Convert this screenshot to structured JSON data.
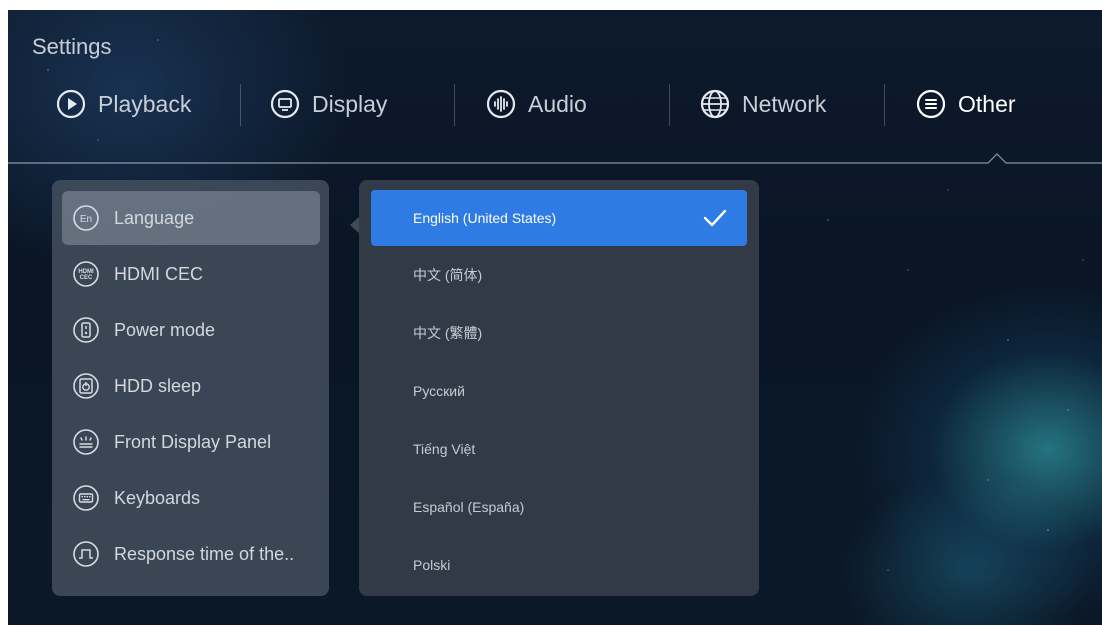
{
  "title": "Settings",
  "tabs": [
    {
      "label": "Playback",
      "icon": "play-circle-icon"
    },
    {
      "label": "Display",
      "icon": "display-icon"
    },
    {
      "label": "Audio",
      "icon": "audio-wave-icon"
    },
    {
      "label": "Network",
      "icon": "globe-icon"
    },
    {
      "label": "Other",
      "icon": "menu-circle-icon"
    }
  ],
  "active_tab": "Other",
  "menu": {
    "items": [
      {
        "label": "Language",
        "icon": "language-icon",
        "icon_text": "En"
      },
      {
        "label": "HDMI CEC",
        "icon": "hdmi-cec-icon",
        "icon_text": "HDMI CEC"
      },
      {
        "label": "Power mode",
        "icon": "power-mode-icon"
      },
      {
        "label": "HDD sleep",
        "icon": "hdd-sleep-icon"
      },
      {
        "label": "Front Display Panel",
        "icon": "front-display-icon"
      },
      {
        "label": "Keyboards",
        "icon": "keyboard-icon"
      },
      {
        "label": "Response time of the..",
        "icon": "pulse-icon"
      }
    ],
    "selected": "Language"
  },
  "languages": {
    "options": [
      {
        "label": "English (United States)"
      },
      {
        "label": "中文 (简体)"
      },
      {
        "label": "中文 (繁體)"
      },
      {
        "label": "Русский"
      },
      {
        "label": "Tiếng Việt"
      },
      {
        "label": "Español (España)"
      },
      {
        "label": "Polski"
      }
    ],
    "selected": "English (United States)"
  },
  "colors": {
    "accent": "#2d7be3",
    "panel": "#465060",
    "text": "#d3d7dd"
  }
}
